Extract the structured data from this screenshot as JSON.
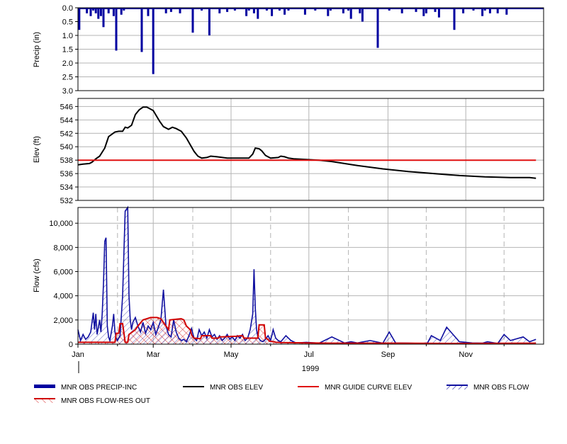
{
  "colors": {
    "precip": "#0000a0",
    "elev": "#000000",
    "guide": "#e01010",
    "flow": "#1010a0",
    "resout": "#d00000",
    "grid": "#b4b4b4",
    "axis": "#000000"
  },
  "chart_data": [
    {
      "type": "bar",
      "ylabel": "Precip (in)",
      "y_inverted": true,
      "ylim": [
        0,
        3.0
      ],
      "yticks": [
        "0.0",
        "0.5",
        "1.0",
        "1.5",
        "2.0",
        "2.5",
        "3.0"
      ],
      "series": [
        {
          "name": "MNR OBS PRECIP-INC",
          "x_day_of_year": [
            2,
            8,
            11,
            13,
            15,
            17,
            19,
            21,
            25,
            29,
            31,
            35,
            37,
            51,
            56,
            60,
            70,
            74,
            81,
            91,
            98,
            104,
            112,
            118,
            124,
            133,
            135,
            139,
            142,
            149,
            153,
            159,
            163,
            166,
            179,
            187,
            197,
            199,
            209,
            213,
            215,
            222,
            224,
            236,
            245,
            255,
            266,
            272,
            274,
            281,
            284,
            296,
            303,
            311,
            318,
            320,
            324,
            330,
            337
          ],
          "values": [
            0.8,
            0.2,
            0.3,
            0.1,
            0.2,
            0.4,
            0.3,
            0.7,
            0.2,
            0.3,
            1.55,
            0.25,
            0.1,
            1.6,
            0.3,
            2.4,
            0.2,
            0.15,
            0.2,
            0.9,
            0.1,
            1.0,
            0.2,
            0.15,
            0.1,
            0.3,
            0.1,
            0.2,
            0.4,
            0.1,
            0.3,
            0.1,
            0.25,
            0.1,
            0.25,
            0.1,
            0.3,
            0.1,
            0.2,
            0.1,
            0.4,
            0.2,
            0.5,
            1.45,
            0.1,
            0.2,
            0.15,
            0.3,
            0.2,
            0.15,
            0.35,
            0.8,
            0.2,
            0.1,
            0.3,
            0.1,
            0.2,
            0.2,
            0.25
          ]
        }
      ]
    },
    {
      "type": "line",
      "ylabel": "Elev (ft)",
      "ylim": [
        532,
        547.2
      ],
      "yticks": [
        "532",
        "534",
        "536",
        "538",
        "540",
        "542",
        "544",
        "546"
      ],
      "series": [
        {
          "name": "MNR OBS ELEV",
          "x_day_of_year": [
            1,
            5,
            10,
            12,
            15,
            18,
            22,
            25,
            30,
            33,
            36,
            38,
            40,
            43,
            46,
            49,
            52,
            55,
            60,
            65,
            68,
            72,
            75,
            78,
            82,
            86,
            89,
            92,
            95,
            98,
            102,
            105,
            110,
            118,
            125,
            130,
            135,
            138,
            140,
            143,
            145,
            148,
            152,
            158,
            160,
            163,
            166,
            170,
            180,
            190,
            200,
            220,
            240,
            260,
            280,
            300,
            320,
            340,
            355,
            360
          ],
          "values": [
            537.3,
            537.4,
            537.5,
            537.7,
            538.2,
            538.6,
            539.8,
            541.5,
            542.2,
            542.3,
            542.3,
            542.9,
            542.8,
            543.2,
            544.8,
            545.5,
            545.9,
            545.9,
            545.4,
            543.8,
            543.0,
            542.6,
            542.9,
            542.7,
            542.3,
            541.3,
            540.3,
            539.3,
            538.6,
            538.3,
            538.4,
            538.6,
            538.5,
            538.3,
            538.3,
            538.3,
            538.3,
            538.9,
            539.8,
            539.7,
            539.4,
            538.7,
            538.3,
            538.4,
            538.6,
            538.5,
            538.3,
            538.2,
            538.1,
            538.0,
            537.8,
            537.2,
            536.7,
            536.3,
            536.0,
            535.7,
            535.5,
            535.4,
            535.4,
            535.3
          ]
        },
        {
          "name": "MNR GUIDE CURVE ELEV",
          "x_day_of_year": [
            1,
            360
          ],
          "values": [
            538,
            538
          ]
        }
      ]
    },
    {
      "type": "area",
      "ylabel": "Flow (cfs)",
      "ylim": [
        0,
        11300
      ],
      "yticks": [
        "0",
        "2,000",
        "4,000",
        "6,000",
        "8,000",
        "10,000"
      ],
      "x_tick_labels": [
        "Jan",
        "Mar",
        "May",
        "Jul",
        "Sep",
        "Nov"
      ],
      "x_year_label": "1999",
      "series": [
        {
          "name": "MNR OBS FLOW",
          "x_day_of_year": [
            1,
            3,
            5,
            7,
            9,
            11,
            12,
            13,
            14,
            15,
            16,
            18,
            19,
            20,
            21,
            22,
            23,
            24,
            25,
            26,
            28,
            29,
            30,
            31,
            32,
            34,
            36,
            38,
            40,
            41,
            42,
            43,
            44,
            46,
            48,
            50,
            52,
            54,
            56,
            58,
            60,
            62,
            64,
            66,
            68,
            70,
            72,
            74,
            76,
            78,
            80,
            82,
            84,
            86,
            88,
            90,
            92,
            94,
            96,
            98,
            100,
            102,
            104,
            106,
            108,
            110,
            112,
            114,
            116,
            118,
            120,
            122,
            124,
            126,
            128,
            130,
            132,
            134,
            136,
            138,
            139,
            140,
            141,
            142,
            144,
            146,
            148,
            150,
            152,
            154,
            156,
            158,
            160,
            164,
            168,
            172,
            180,
            190,
            200,
            210,
            215,
            220,
            230,
            240,
            245,
            250,
            260,
            270,
            275,
            278,
            285,
            290,
            300,
            310,
            318,
            322,
            330,
            335,
            340,
            350,
            355,
            360
          ],
          "values": [
            1200,
            300,
            800,
            400,
            600,
            1000,
            1800,
            2600,
            1200,
            2500,
            800,
            2000,
            1000,
            2500,
            5000,
            8500,
            8800,
            1500,
            600,
            300,
            1500,
            2500,
            1000,
            500,
            300,
            700,
            4000,
            11000,
            11300,
            4000,
            2000,
            1200,
            1800,
            2200,
            1500,
            1000,
            1800,
            900,
            1500,
            1200,
            1800,
            800,
            1400,
            2000,
            4500,
            1500,
            800,
            600,
            2000,
            1000,
            500,
            300,
            400,
            200,
            700,
            1300,
            500,
            300,
            1200,
            700,
            1000,
            500,
            1200,
            600,
            800,
            400,
            700,
            300,
            500,
            800,
            400,
            600,
            300,
            700,
            500,
            800,
            300,
            500,
            1200,
            2500,
            6200,
            3000,
            1200,
            600,
            300,
            200,
            400,
            700,
            300,
            1200,
            500,
            300,
            200,
            700,
            300,
            100,
            150,
            80,
            600,
            100,
            200,
            100,
            300,
            80,
            1000,
            100,
            80,
            60,
            100,
            700,
            300,
            1400,
            200,
            100,
            80,
            200,
            50,
            800,
            300,
            600,
            200,
            400
          ]
        },
        {
          "name": "MNR OBS FLOW-RES OUT",
          "x_day_of_year": [
            1,
            20,
            30,
            31,
            33,
            34,
            36,
            38,
            40,
            41,
            46,
            48,
            52,
            58,
            63,
            66,
            68,
            72,
            73,
            82,
            84,
            86,
            89,
            90,
            91,
            92,
            97,
            98,
            105,
            106,
            111,
            112,
            125,
            130,
            131,
            140,
            142,
            143,
            147,
            148,
            150,
            151,
            155,
            156,
            160,
            180,
            200,
            250,
            300,
            360
          ],
          "values": [
            150,
            150,
            150,
            900,
            900,
            1700,
            1700,
            150,
            150,
            800,
            1200,
            1500,
            2000,
            2200,
            2200,
            2100,
            1800,
            1200,
            2000,
            2100,
            2000,
            1500,
            1200,
            800,
            600,
            500,
            450,
            700,
            700,
            500,
            500,
            600,
            650,
            700,
            500,
            500,
            500,
            1600,
            1600,
            500,
            400,
            250,
            200,
            150,
            130,
            100,
            80,
            80,
            60,
            80
          ]
        }
      ]
    }
  ],
  "legend": [
    {
      "label": "MNR OBS PRECIP-INC",
      "style": "thick-blue"
    },
    {
      "label": "MNR OBS ELEV",
      "style": "black-line"
    },
    {
      "label": "MNR GUIDE CURVE ELEV",
      "style": "red-line"
    },
    {
      "label": "MNR OBS FLOW",
      "style": "blue-hatch"
    },
    {
      "label": "MNR OBS FLOW-RES OUT",
      "style": "red-hatch"
    }
  ]
}
